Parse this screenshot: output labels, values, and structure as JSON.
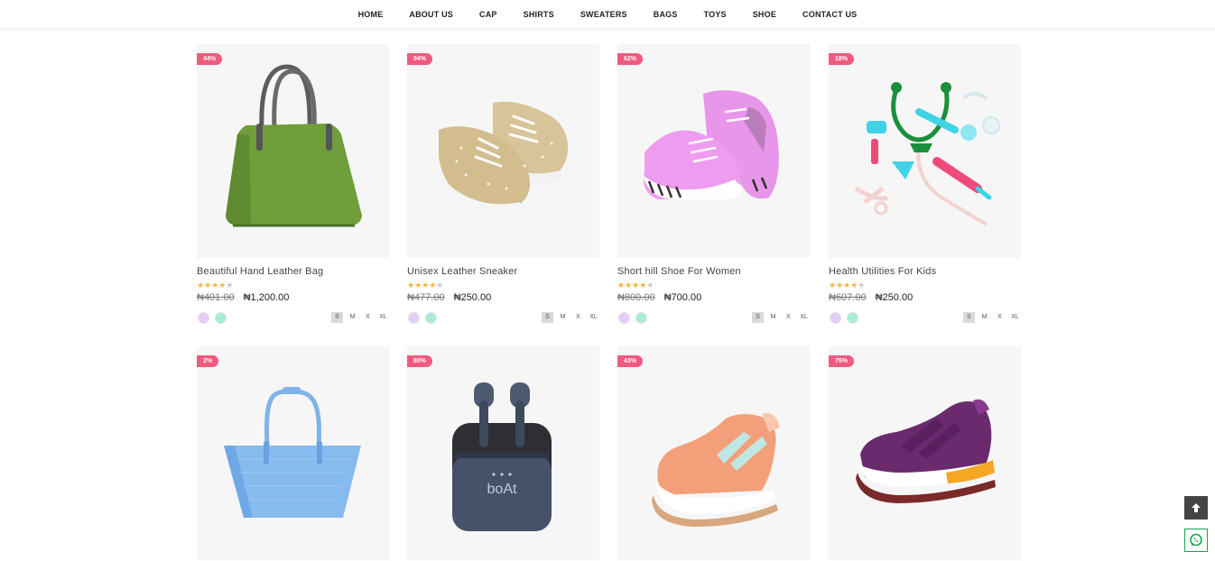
{
  "nav": {
    "items": [
      "HOME",
      "ABOUT US",
      "CAP",
      "SHIRTS",
      "SWEATERS",
      "BAGS",
      "TOYS",
      "SHOE",
      "CONTACT US"
    ]
  },
  "products": [
    {
      "badge": "44%",
      "title": "Beautiful Hand Leather Bag",
      "old_price": "₦401.00",
      "price": "₦1,200.00",
      "rating": 4,
      "colors": [
        "#e6ccf8",
        "#a9ecd1"
      ],
      "sizes": [
        "S",
        "M",
        "X",
        "XL"
      ],
      "image": "green-leather-bag"
    },
    {
      "badge": "94%",
      "title": "Unisex Leather Sneaker",
      "old_price": "₦477.00",
      "price": "₦250.00",
      "rating": 4,
      "colors": [
        "#e6ccf8",
        "#a9ecd1"
      ],
      "sizes": [
        "S",
        "M",
        "X",
        "XL"
      ],
      "image": "beige-sneakers"
    },
    {
      "badge": "62%",
      "title": "Short hill Shoe For Women",
      "old_price": "₦800.00",
      "price": "₦700.00",
      "rating": 4,
      "colors": [
        "#e6ccf8",
        "#a9ecd1"
      ],
      "sizes": [
        "S",
        "M",
        "X",
        "XL"
      ],
      "image": "pink-baby-shoes"
    },
    {
      "badge": "18%",
      "title": "Health Utilities For Kids",
      "old_price": "₦607.00",
      "price": "₦250.00",
      "rating": 4,
      "colors": [
        "#e6ccf8",
        "#a9ecd1"
      ],
      "sizes": [
        "S",
        "M",
        "X",
        "XL"
      ],
      "image": "toy-doctor-kit"
    },
    {
      "badge": "2%",
      "image": "blue-tote-bag"
    },
    {
      "badge": "80%",
      "image": "earbuds-case",
      "image_text": "boAt"
    },
    {
      "badge": "43%",
      "image": "peach-running-shoe"
    },
    {
      "badge": "75%",
      "image": "purple-running-shoe"
    }
  ],
  "icons": {
    "scroll_top": "arrow-up-icon",
    "whatsapp": "whatsapp-icon"
  },
  "colors": {
    "badge": "#f05a7e",
    "star": "#f3b53f",
    "whatsapp": "#1aa44f"
  }
}
